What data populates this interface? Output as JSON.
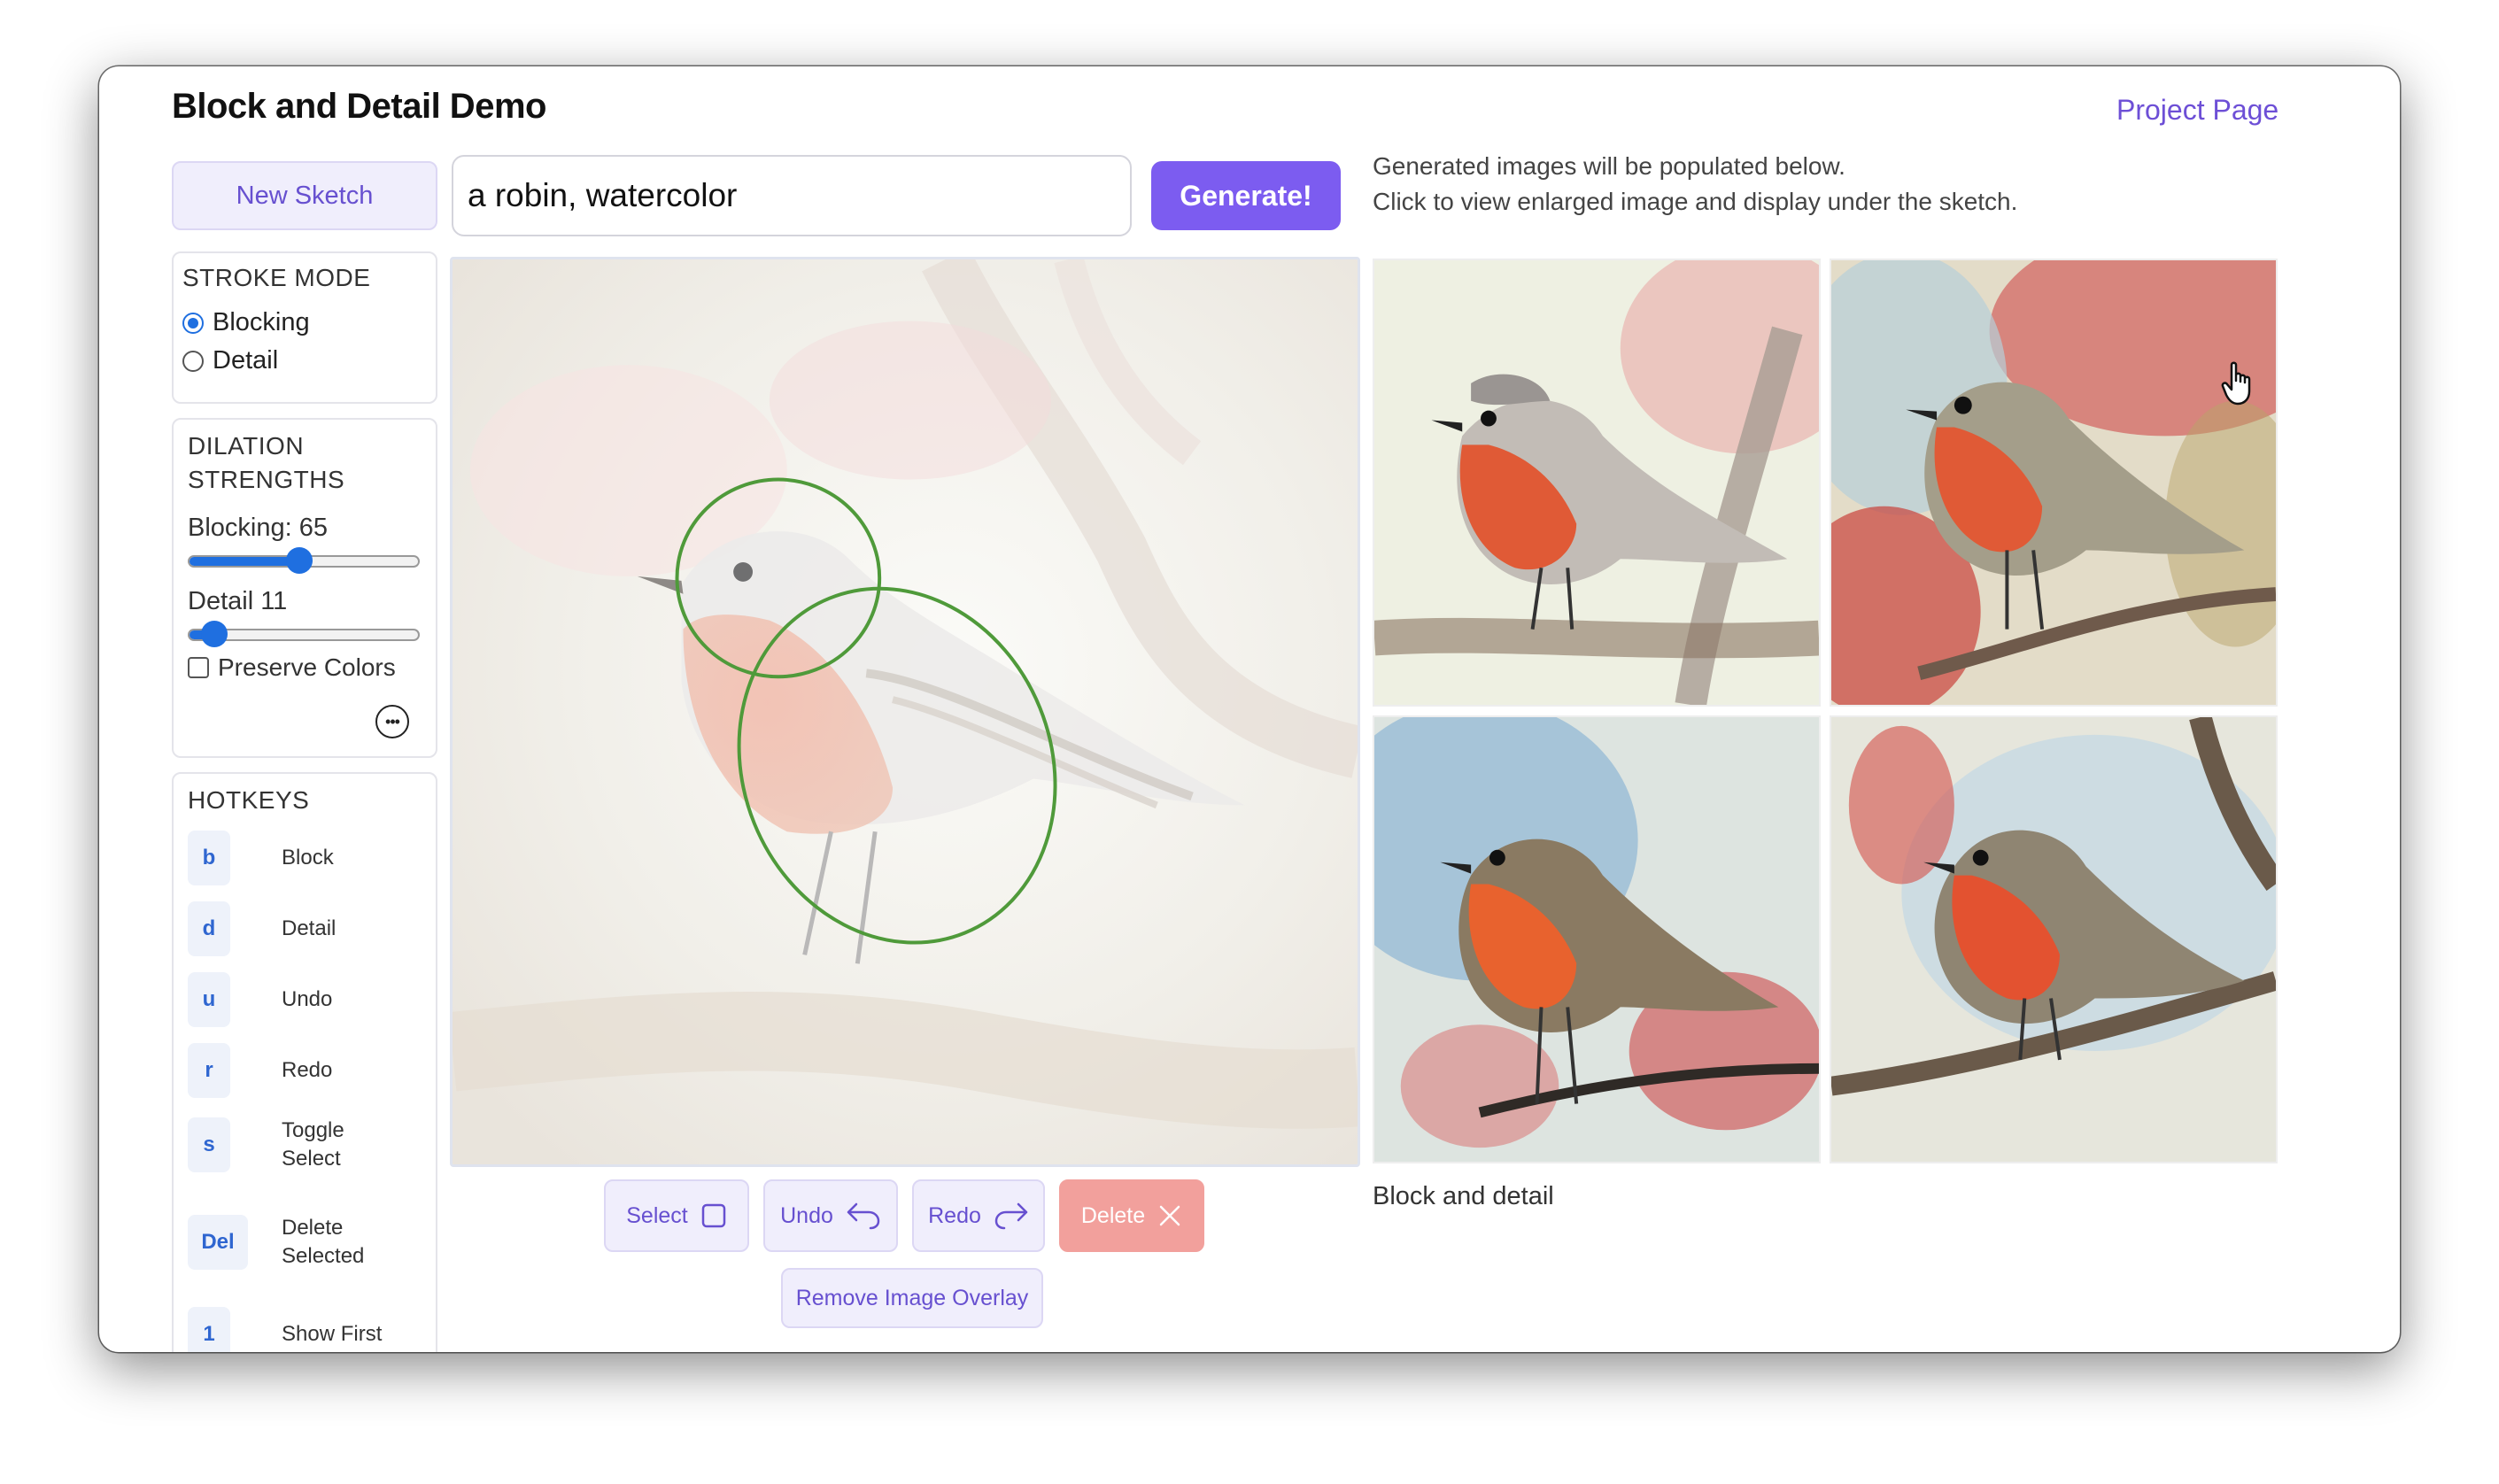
{
  "app": {
    "title": "Block and Detail Demo",
    "project_link": "Project Page"
  },
  "toolbar": {
    "new_sketch_label": "New Sketch",
    "prompt_value": "a robin, watercolor",
    "generate_label": "Generate!",
    "info_line1": "Generated images will be populated below.",
    "info_line2": "Click to view enlarged image and display under the sketch."
  },
  "stroke_mode": {
    "heading": "STROKE MODE",
    "options": [
      "Blocking",
      "Detail"
    ],
    "selected": "Blocking"
  },
  "dilation": {
    "heading_line1": "DILATION",
    "heading_line2": "STRENGTHS",
    "blocking_label": "Blocking: 65",
    "blocking_value": 65,
    "detail_label": "Detail 11",
    "detail_value": 11,
    "preserve_colors_label": "Preserve Colors",
    "preserve_colors_checked": false,
    "more_icon": "ellipsis-circle-icon"
  },
  "hotkeys": {
    "heading": "HOTKEYS",
    "items": [
      {
        "key": "b",
        "label": "Block"
      },
      {
        "key": "d",
        "label": "Detail"
      },
      {
        "key": "u",
        "label": "Undo"
      },
      {
        "key": "r",
        "label": "Redo"
      },
      {
        "key": "s",
        "label": "Toggle\nSelect"
      },
      {
        "key": "Del",
        "label": "Delete\nSelected"
      },
      {
        "key": "1",
        "label": "Show First"
      }
    ]
  },
  "canvas_tools": {
    "select_label": "Select",
    "undo_label": "Undo",
    "redo_label": "Redo",
    "delete_label": "Delete",
    "remove_overlay_label": "Remove Image Overlay"
  },
  "gallery": {
    "caption": "Block and detail",
    "images": [
      "robin-watercolor-1",
      "robin-watercolor-2",
      "robin-watercolor-3",
      "robin-watercolor-4"
    ]
  },
  "colors": {
    "accent": "#7c5cf0",
    "link": "#6d4fd6",
    "stroke": "#4f9a3a",
    "delete": "#f2a09c",
    "robin_breast": "#e05a36"
  }
}
